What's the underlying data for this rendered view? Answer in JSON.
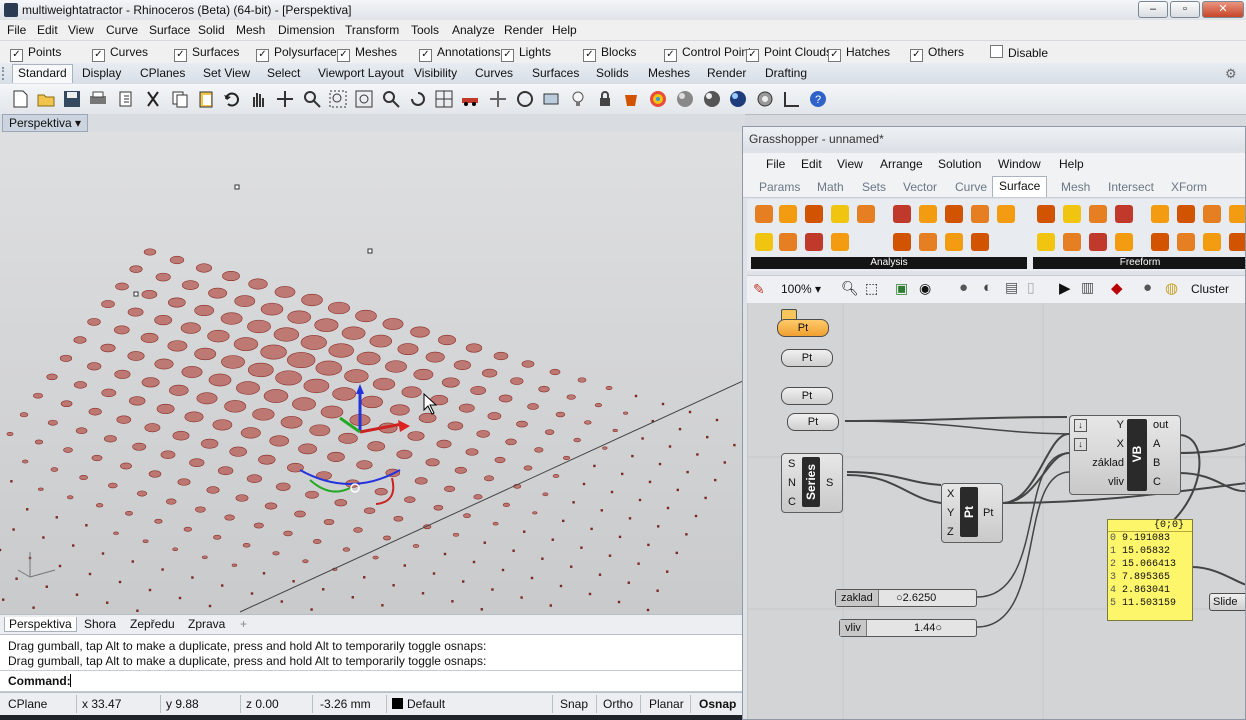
{
  "window": {
    "title": "multiweightatractor - Rhinoceros (Beta) (64-bit) - [Perspektiva]"
  },
  "menu": [
    "File",
    "Edit",
    "View",
    "Curve",
    "Surface",
    "Solid",
    "Mesh",
    "Dimension",
    "Transform",
    "Tools",
    "Analyze",
    "Render",
    "Help"
  ],
  "filters": [
    "Points",
    "Curves",
    "Surfaces",
    "Polysurfaces",
    "Meshes",
    "Annotations",
    "Lights",
    "Blocks",
    "Control Points",
    "Point Clouds",
    "Hatches",
    "Others"
  ],
  "filter_disable": "Disable",
  "tabs": [
    "Standard",
    "Display",
    "CPlanes",
    "Set View",
    "Select",
    "Viewport Layout",
    "Visibility",
    "Curves",
    "Surfaces",
    "Solids",
    "Meshes",
    "Render",
    "Drafting"
  ],
  "viewport": {
    "label": "Perspektiva"
  },
  "viewport_tabs": [
    "Perspektiva",
    "Shora",
    "Zepředu",
    "Zprava"
  ],
  "command": {
    "history": [
      "Drag gumball, tap Alt to make a duplicate, press and hold Alt to temporarily toggle osnaps:",
      "Drag gumball, tap Alt to make a duplicate, press and hold Alt to temporarily toggle osnaps:"
    ],
    "prompt": "Command:"
  },
  "status": {
    "cplane": "CPlane",
    "x": "x 33.47",
    "y": "y 9.88",
    "z": "z 0.00",
    "dist": "-3.26 mm",
    "layer": "Default",
    "snap": "Snap",
    "ortho": "Ortho",
    "planar": "Planar",
    "osnap": "Osnap"
  },
  "grasshopper": {
    "title": "Grasshopper - unnamed*",
    "menu": [
      "File",
      "Edit",
      "View",
      "Arrange",
      "Solution",
      "Window",
      "Help"
    ],
    "tabs": [
      "Params",
      "Math",
      "Sets",
      "Vector",
      "Curve",
      "Surface",
      "Mesh",
      "Intersect",
      "XForm"
    ],
    "ribbon_groups": [
      "Analysis",
      "Freeform"
    ],
    "zoom": "100%",
    "cluster": "Cluster",
    "nodes": {
      "pt_label": "Pt",
      "series": {
        "title": "Series",
        "inputs": [
          "S",
          "N",
          "C"
        ],
        "output": "S"
      },
      "ptnode": {
        "title": "Pt",
        "inputs": [
          "X",
          "Y",
          "Z"
        ],
        "output": "Pt"
      },
      "vb": {
        "title": "VB",
        "inputs": [
          "Y",
          "X",
          "základ",
          "vliv"
        ],
        "outputs": [
          "out",
          "A",
          "B",
          "C"
        ]
      }
    },
    "sliders": [
      {
        "label": "zaklad",
        "value": "2.6250"
      },
      {
        "label": "vliv",
        "value": "1.44"
      }
    ],
    "panel": {
      "header": "{0;0}",
      "items": [
        "9.191083",
        "15.05832",
        "15.066413",
        "7.895365",
        "2.863041",
        "11.503159"
      ]
    },
    "slider_stub": "Slide"
  }
}
